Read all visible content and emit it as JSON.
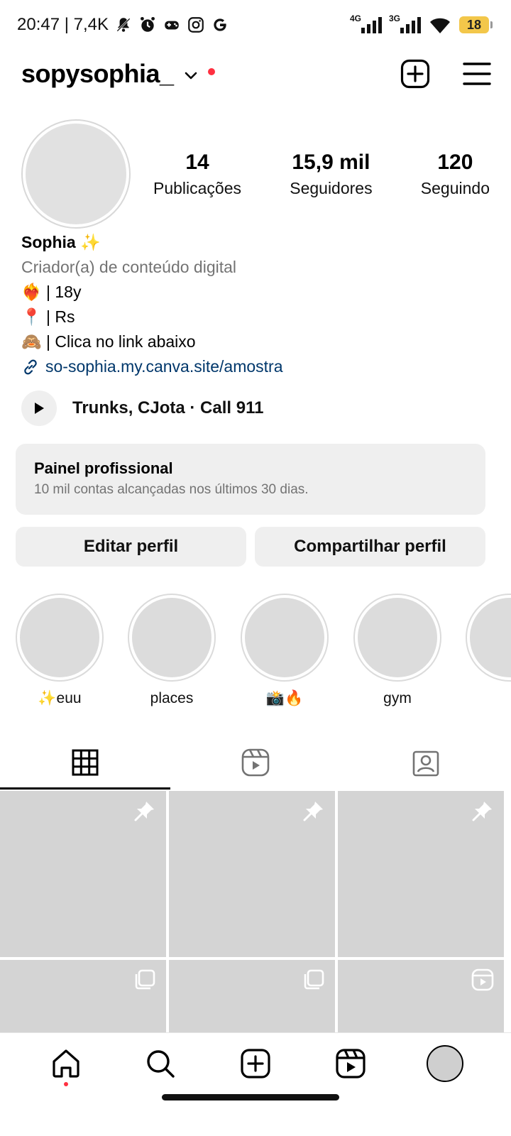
{
  "status_bar": {
    "time_text": "20:47 | 7,4K",
    "net_4g": "4G",
    "net_3g": "3G",
    "battery": "18"
  },
  "header": {
    "username": "sopysophia_"
  },
  "profile": {
    "posts_count": "14",
    "posts_label": "Publicações",
    "followers_count": "15,9 mil",
    "followers_label": "Seguidores",
    "following_count": "120",
    "following_label": "Seguindo"
  },
  "bio": {
    "name": "Sophia ✨",
    "category": "Criador(a) de conteúdo digital",
    "line1": "❤️‍🔥 | 18y",
    "line2": "📍 | Rs",
    "line3": "🙈 | Clica no link abaixo",
    "link": "so-sophia.my.canva.site/amostra"
  },
  "music": {
    "text": "Trunks, CJota · Call 911"
  },
  "dashboard": {
    "title": "Painel profissional",
    "subtitle": "10 mil contas alcançadas nos últimos 30 dias."
  },
  "buttons": {
    "edit": "Editar perfil",
    "share": "Compartilhar perfil"
  },
  "highlights": [
    {
      "label": "✨euu"
    },
    {
      "label": "places"
    },
    {
      "label": "📸🔥"
    },
    {
      "label": "gym"
    },
    {
      "label": ""
    }
  ],
  "colors": {
    "accent_red": "#ff3040",
    "link_blue": "#00376b",
    "button_gray": "#efefef",
    "secondary_text": "#737373"
  },
  "icons": {
    "top_actions": [
      "new-post-icon",
      "menu-icon"
    ],
    "tabs": [
      "grid-icon",
      "reels-icon",
      "tagged-icon"
    ],
    "grid_badges": [
      "pin-icon",
      "pin-icon",
      "pin-icon",
      "carousel-icon",
      "carousel-icon",
      "reel-icon"
    ],
    "bottom_nav": [
      "home-icon",
      "search-icon",
      "create-icon",
      "reels-icon",
      "profile-avatar"
    ]
  }
}
